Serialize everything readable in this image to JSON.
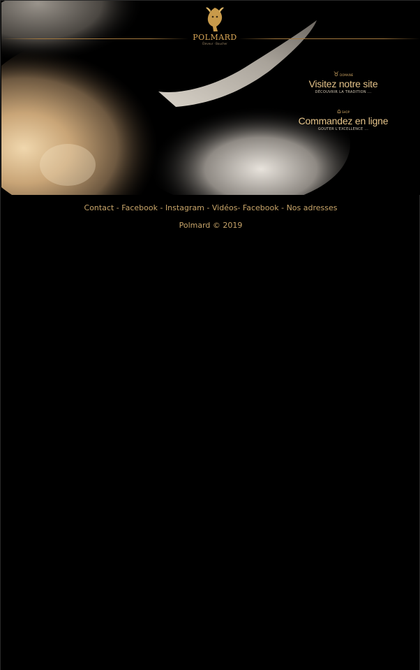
{
  "brand": {
    "name": "POLMARD",
    "tagline": "Éleveur · Boucher"
  },
  "cta": [
    {
      "icon": "bull-icon",
      "icon_label": "DOMAINE",
      "title": "Visitez notre site",
      "subtitle": "DÉCOUVRIR LA TRADITION ..."
    },
    {
      "icon": "home-icon",
      "icon_label": "SHOP",
      "title": "Commandez en ligne",
      "subtitle": "GOUTER L'EXCELLENCE ..."
    }
  ],
  "footer": {
    "links": [
      {
        "label": "Contact"
      },
      {
        "label": "Facebook"
      },
      {
        "label": "Instagram"
      },
      {
        "label": "Vidéos"
      },
      {
        "label": "Facebook"
      },
      {
        "label": "Nos adresses"
      }
    ],
    "separators": [
      " - ",
      " - ",
      " - ",
      "- ",
      " - "
    ],
    "copyright": "Polmard © 2019"
  },
  "colors": {
    "background": "#000000",
    "accent_gold": "#d7a556",
    "link_text": "#c8a56a"
  }
}
